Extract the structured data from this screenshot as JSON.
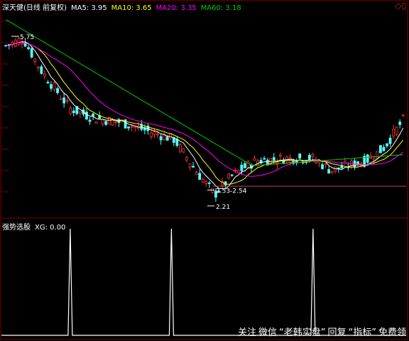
{
  "header": {
    "title": "深天健(日线 前复权)",
    "ma5": "MA5: 3.95",
    "ma10": "MA10: 3.65",
    "ma20": "MA20: 3.35",
    "ma60": "MA60: 3.18"
  },
  "indicator_header": {
    "name": "强势选股",
    "xg": "XG: 0.00"
  },
  "watermark": {
    "left": "关注",
    "account": "微信",
    "quote1": "“老韩实盘”",
    "reply": "回复",
    "quote2": "“指标”",
    "tail": "免费领"
  },
  "colors": {
    "up": "#ff3232",
    "down": "#54ffff",
    "ma5": "#ffffff",
    "ma10": "#ffff00",
    "ma20": "#ff00ff",
    "ma60": "#00cc00",
    "grid": "#7a0000",
    "signal": "#ffffff"
  },
  "chart_data": [
    {
      "type": "candlestick",
      "annotations": [
        {
          "label": "5.75",
          "price": 5.75
        },
        {
          "label": "2.53-2.54",
          "price": 2.54
        },
        {
          "label": "2.21",
          "price": 2.21
        }
      ],
      "price_range": [
        2.0,
        6.3
      ],
      "reference_line": 2.62,
      "series": [
        {
          "name": "MA5",
          "value": 3.95
        },
        {
          "name": "MA10",
          "value": 3.65
        },
        {
          "name": "MA20",
          "value": 3.35
        },
        {
          "name": "MA60",
          "value": 3.18
        }
      ]
    },
    {
      "type": "line",
      "name": "强势选股",
      "series_name": "XG",
      "current": 0.0,
      "y_range": [
        0,
        1
      ],
      "signal_bars": [
        17,
        42,
        77
      ]
    }
  ]
}
